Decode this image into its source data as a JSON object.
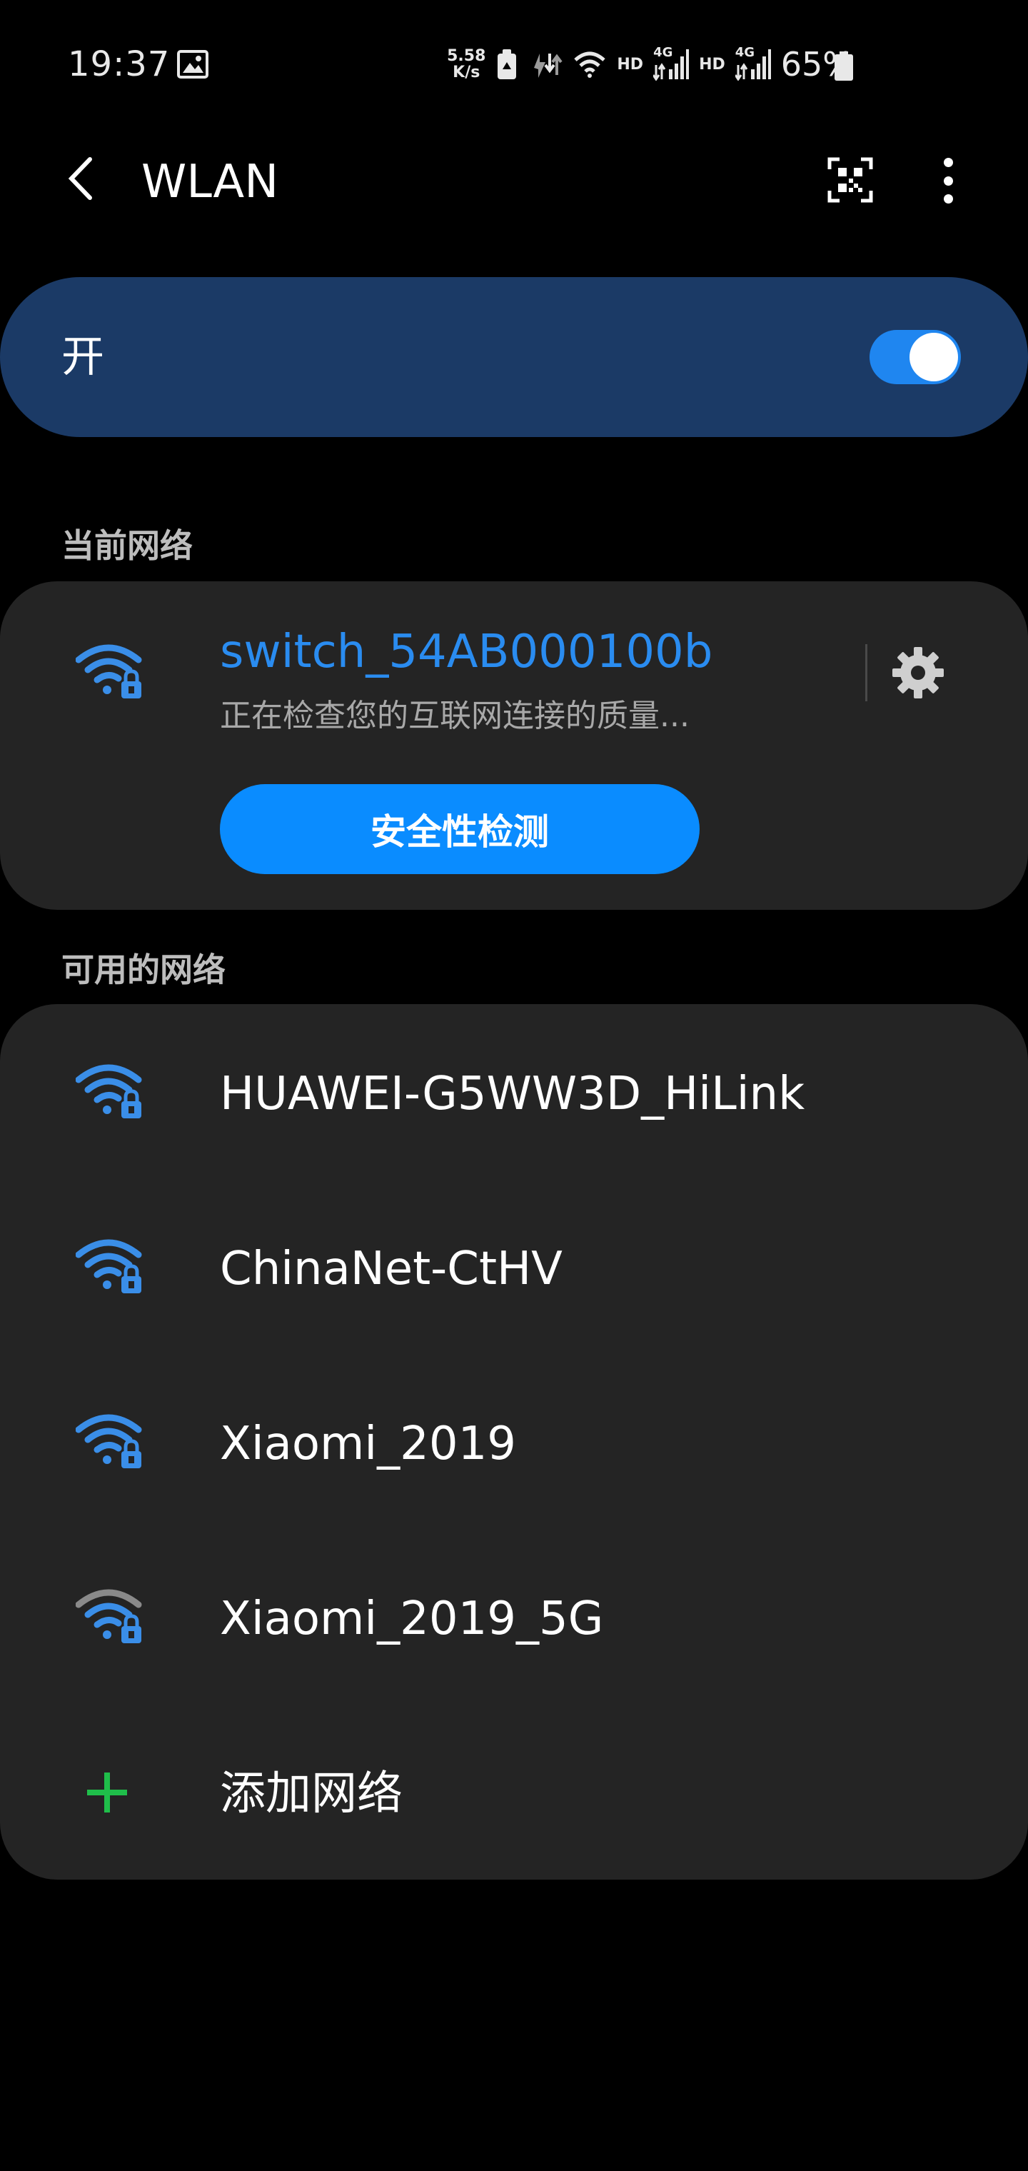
{
  "status_bar": {
    "time": "19:37",
    "net_speed_value": "5.58",
    "net_speed_unit": "K/s",
    "hd_1": "HD",
    "hd_2": "HD",
    "sig_1_type": "4G",
    "sig_2_type": "4G",
    "battery": "65%"
  },
  "header": {
    "title": "WLAN"
  },
  "master_switch": {
    "label": "开",
    "on": true
  },
  "current_section": {
    "title": "当前网络",
    "network_name": "switch_54AB000100b",
    "status": "正在检查您的互联网连接的质量...",
    "security_button": "安全性检测"
  },
  "available_section": {
    "title": "可用的网络",
    "networks": [
      {
        "name": "HUAWEI-G5WW3D_HiLink",
        "icon": "wifi-lock-icon"
      },
      {
        "name": "ChinaNet-CtHV",
        "icon": "wifi-lock-icon"
      },
      {
        "name": "Xiaomi_2019",
        "icon": "wifi-lock-icon"
      },
      {
        "name": "Xiaomi_2019_5G",
        "icon": "wifi-lock-icon"
      }
    ],
    "add_label": "添加网络"
  },
  "colors": {
    "accent": "#2a8cf0",
    "switch_card": "#1b3a66",
    "card": "#242424",
    "security_button": "#0a8cff",
    "add_icon": "#1fbe4a",
    "wifi_signal": "#3a8ee8"
  }
}
